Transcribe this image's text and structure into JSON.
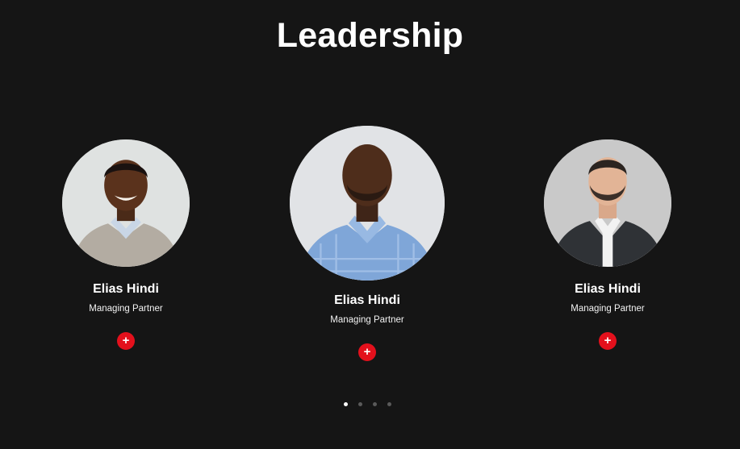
{
  "section": {
    "title": "Leadership"
  },
  "team": [
    {
      "name": "Elias Hindi",
      "role": "Managing Partner",
      "more": "+"
    },
    {
      "name": "Elias Hindi",
      "role": "Managing Partner",
      "more": "+"
    },
    {
      "name": "Elias Hindi",
      "role": "Managing Partner",
      "more": "+"
    }
  ],
  "carousel": {
    "dot_count": 4,
    "active_index": 0
  },
  "colors": {
    "background": "#151515",
    "accent": "#e3101c",
    "text": "#ffffff"
  },
  "icons": {
    "more": "plus-icon"
  }
}
